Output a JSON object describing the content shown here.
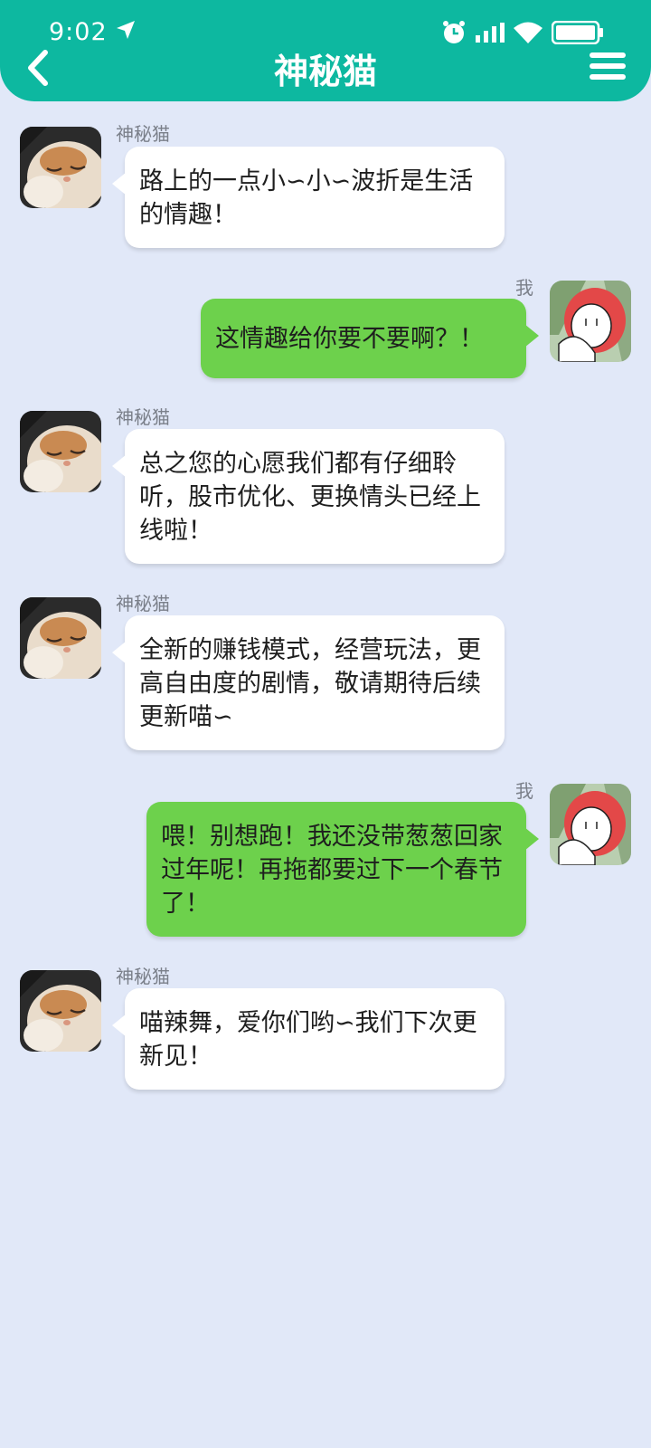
{
  "status_bar": {
    "time": "9:02",
    "icons": [
      "location-arrow-icon",
      "alarm-icon",
      "signal-icon",
      "wifi-icon",
      "battery-icon"
    ]
  },
  "header": {
    "title": "神秘猫",
    "back_icon": "back-arrow-icon",
    "menu_icon": "menu-icon"
  },
  "colors": {
    "header": "#0db8a0",
    "background": "#e1e8f8",
    "incoming_bubble": "#ffffff",
    "outgoing_bubble": "#6dd14c"
  },
  "messages": [
    {
      "sender": "神秘猫",
      "direction": "in",
      "text": "路上的一点小∽小∽波折是生活的情趣！"
    },
    {
      "sender": "我",
      "direction": "out",
      "text": "这情趣给你要不要啊？！"
    },
    {
      "sender": "神秘猫",
      "direction": "in",
      "text": "总之您的心愿我们都有仔细聆听，股市优化、更换情头已经上线啦！"
    },
    {
      "sender": "神秘猫",
      "direction": "in",
      "text": "全新的赚钱模式，经营玩法，更高自由度的剧情，敬请期待后续更新喵∽"
    },
    {
      "sender": "我",
      "direction": "out",
      "text": "喂！别想跑！我还没带葱葱回家过年呢！再拖都要过下一个春节了！"
    },
    {
      "sender": "神秘猫",
      "direction": "in",
      "text": "喵辣舞，爱你们哟∽我们下次更新见！"
    }
  ]
}
